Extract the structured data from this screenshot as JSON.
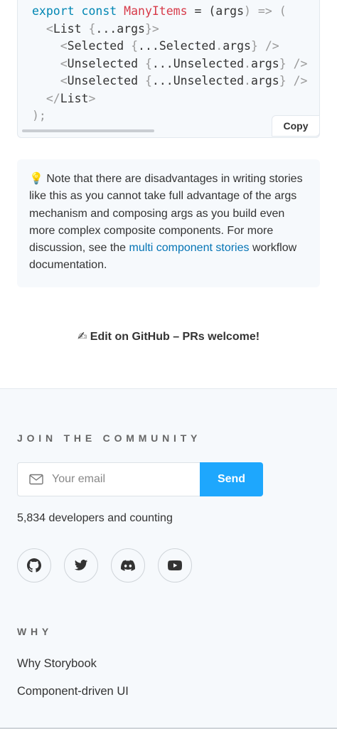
{
  "code": {
    "lines": [
      [
        {
          "t": "export const ",
          "c": "kw"
        },
        {
          "t": "ManyItems",
          "c": "fn"
        },
        {
          "t": " = (",
          "c": "tag"
        },
        {
          "t": "args",
          "c": "tag"
        },
        {
          "t": ") => (",
          "c": "punc"
        }
      ],
      [
        {
          "t": "  <",
          "c": "punc"
        },
        {
          "t": "List ",
          "c": "tag"
        },
        {
          "t": "{",
          "c": "punc"
        },
        {
          "t": "...args",
          "c": "tag"
        },
        {
          "t": "}>",
          "c": "punc"
        }
      ],
      [
        {
          "t": "    <",
          "c": "punc"
        },
        {
          "t": "Selected ",
          "c": "tag"
        },
        {
          "t": "{",
          "c": "punc"
        },
        {
          "t": "...Selected",
          "c": "tag"
        },
        {
          "t": ".",
          "c": "punc"
        },
        {
          "t": "args",
          "c": "tag"
        },
        {
          "t": "} />",
          "c": "punc"
        }
      ],
      [
        {
          "t": "    <",
          "c": "punc"
        },
        {
          "t": "Unselected ",
          "c": "tag"
        },
        {
          "t": "{",
          "c": "punc"
        },
        {
          "t": "...Unselected",
          "c": "tag"
        },
        {
          "t": ".",
          "c": "punc"
        },
        {
          "t": "args",
          "c": "tag"
        },
        {
          "t": "} />",
          "c": "punc"
        }
      ],
      [
        {
          "t": "    <",
          "c": "punc"
        },
        {
          "t": "Unselected ",
          "c": "tag"
        },
        {
          "t": "{",
          "c": "punc"
        },
        {
          "t": "...Unselected",
          "c": "tag"
        },
        {
          "t": ".",
          "c": "punc"
        },
        {
          "t": "args",
          "c": "tag"
        },
        {
          "t": "} />",
          "c": "punc"
        }
      ],
      [
        {
          "t": "  </",
          "c": "punc"
        },
        {
          "t": "List",
          "c": "tag"
        },
        {
          "t": ">",
          "c": "punc"
        }
      ],
      [
        {
          "t": ");",
          "c": "punc"
        }
      ]
    ],
    "copy_label": "Copy"
  },
  "note": {
    "emoji": "💡",
    "text_before": " Note that there are disadvantages in writing stories like this as you cannot take full advantage of the args mechanism and composing args as you build even more complex composite components. For more discussion, see the ",
    "link_text": "multi component stories",
    "text_after": " workflow documentation."
  },
  "edit": {
    "label": "✍ Edit on GitHub – PRs welcome!"
  },
  "footer": {
    "community_heading": "JOIN THE COMMUNITY",
    "email_placeholder": "Your email",
    "send_label": "Send",
    "developer_count": "5,834 developers and counting",
    "socials": [
      "github-icon",
      "twitter-icon",
      "discord-icon",
      "youtube-icon"
    ],
    "why_heading": "WHY",
    "why_links": [
      "Why Storybook",
      "Component-driven UI"
    ]
  },
  "colors": {
    "accent": "#1ea7fd",
    "link": "#0474b5",
    "keyword": "#0086b3",
    "function": "#d73a49"
  }
}
